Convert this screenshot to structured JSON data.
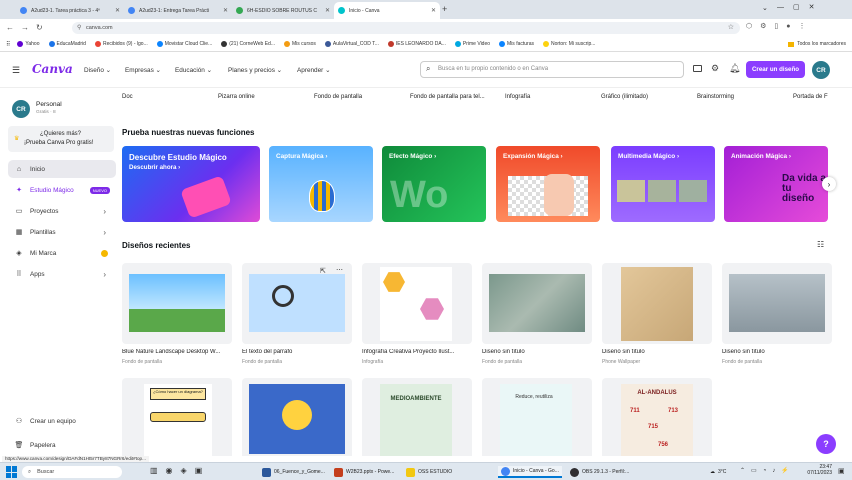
{
  "browser": {
    "tabs": [
      {
        "label": "A2ud23-1. Tarea práctica 3 - 4º",
        "color": "#4285f4"
      },
      {
        "label": "A2ud23-1: Entrega Tarea Prácti",
        "color": "#4285f4"
      },
      {
        "label": "6H-ESDIO SOBRE ROUTUS C",
        "color": "#4285f4"
      },
      {
        "label": "Inicio - Canva",
        "color": "#00c4cc"
      }
    ],
    "new_tab": "+",
    "url": "canva.com",
    "bookmarks": [
      {
        "label": "Yahoo",
        "color": "#6001d2"
      },
      {
        "label": "EducaMadrid",
        "color": "#1a73e8"
      },
      {
        "label": "Recibidos (9) - lgo...",
        "color": "#ea4335"
      },
      {
        "label": "Movistar Cloud Clie...",
        "color": "#0b84ff"
      },
      {
        "label": "(21) CorneWeb Ed...",
        "color": "#333"
      },
      {
        "label": "Mis cursos",
        "color": "#f39c12"
      },
      {
        "label": "AulaVirtual_COD T...",
        "color": "#3b5998"
      },
      {
        "label": "IES LEONARDO DA...",
        "color": "#c0392b"
      },
      {
        "label": "Prime Video",
        "color": "#00a8e1"
      },
      {
        "label": "Mis facturas",
        "color": "#0b84ff"
      },
      {
        "label": "Norton: Mi suscrip...",
        "color": "#fcd20f"
      }
    ],
    "bookmarks_right": "Todos los marcadores"
  },
  "header": {
    "logo": "Canva",
    "nav": [
      "Diseño",
      "Empresas",
      "Educación",
      "Planes y precios",
      "Aprender"
    ],
    "search_placeholder": "Busca en tu propio contenido o en Canva",
    "create_button": "Crear un diseño",
    "avatar": "CR",
    "accent": "#8b3dff"
  },
  "sidebar": {
    "avatar": "CR",
    "name": "Personal",
    "plan": "Gratis · 8",
    "promo_line1": "¿Quieres más?",
    "promo_line2": "¡Prueba Canva Pro gratis!",
    "items": [
      {
        "label": "Inicio",
        "icon": "home-icon"
      },
      {
        "label": "Estudio Mágico",
        "icon": "sparkle-icon",
        "badge": "NUEVO"
      },
      {
        "label": "Proyectos",
        "icon": "folder-icon"
      },
      {
        "label": "Plantillas",
        "icon": "template-icon"
      },
      {
        "label": "Mi Marca",
        "icon": "brand-icon"
      },
      {
        "label": "Apps",
        "icon": "apps-icon"
      }
    ],
    "bottom": [
      {
        "label": "Crear un equipo",
        "icon": "team-icon"
      },
      {
        "label": "Papelera",
        "icon": "trash-icon"
      }
    ]
  },
  "shortcuts": [
    "Doc",
    "Pizarra online",
    "Fondo de pantalla",
    "Fondo de pantalla para tel...",
    "Infografía",
    "Gráfico (ilimitado)",
    "Brainstorming",
    "Portada de F"
  ],
  "features": {
    "title": "Prueba nuestras nuevas funciones",
    "cards": [
      {
        "label": "Descubre Estudio Mágico",
        "sub": "Descubrir ahora ›",
        "color": "#1d6cf2"
      },
      {
        "label": "Captura Mágica ›",
        "color": "#4aa3ff"
      },
      {
        "label": "Efecto Mágico ›",
        "color": "#0fa955"
      },
      {
        "label": "Expansión Mágica ›",
        "color": "#ef5a3c"
      },
      {
        "label": "Multimedia Mágico ›",
        "color": "#7b3dff"
      },
      {
        "label": "Animación Mágica ›",
        "color": "#c125d6",
        "extra": "Da vida a tu diseño"
      }
    ]
  },
  "recent": {
    "title": "Diseños recientes",
    "items": [
      {
        "title": "Blue Nature Landscape Desktop W...",
        "type": "Fondo de pantalla"
      },
      {
        "title": "El texto del párrafo",
        "type": "Fondo de pantalla"
      },
      {
        "title": "Infografía Creativa Proyecto Ilust...",
        "type": "Infografía"
      },
      {
        "title": "Diseño sin título",
        "type": "Fondo de pantalla"
      },
      {
        "title": "Diseño sin título",
        "type": "Phone Wallpaper"
      },
      {
        "title": "Diseño sin título",
        "type": "Fondo de pantalla"
      }
    ],
    "row2_texts": [
      "¿Cómo hacer un diagrama?",
      "",
      "MEDIOAMBIENTE",
      "Reduce, reutiliza",
      "AL-ANDALUS"
    ],
    "andalus_numbers": [
      "711",
      "713",
      "715",
      "756"
    ]
  },
  "help": "?",
  "status_url": "https://www.canva.com/design/DAFdN1Ht5r7TBy87NGRr6/edit#top...",
  "taskbar": {
    "search": "Buscar",
    "apps": [
      {
        "label": "06_Fuence_y_Gome...",
        "color": "#2b579a"
      },
      {
        "label": "W2B23.pptx - Powe...",
        "color": "#c43e1c"
      },
      {
        "label": "OSS ESTUDIO",
        "color": "#f2c811"
      },
      {
        "label": "Inicio - Canva - Go...",
        "color": "#4285f4"
      },
      {
        "label": "OBS 29.1.3 - Perfil:...",
        "color": "#302e31"
      }
    ],
    "temp": "3°C",
    "time": "23:47",
    "date": "07/11/2023"
  }
}
